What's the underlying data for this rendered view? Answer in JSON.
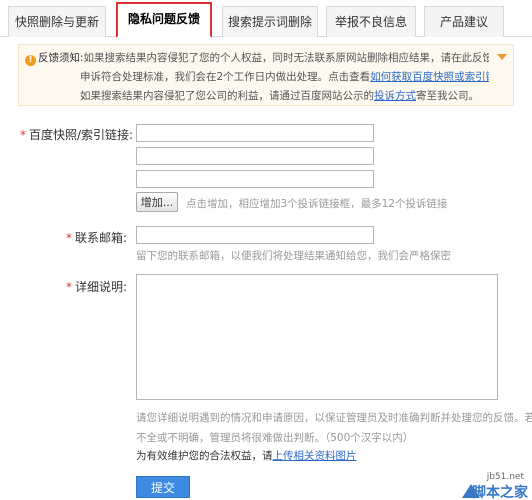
{
  "tabs": [
    {
      "label": "快照删除与更新",
      "active": false
    },
    {
      "label": "隐私问题反馈",
      "active": true
    },
    {
      "label": "搜索提示词删除",
      "active": false
    },
    {
      "label": "举报不良信息",
      "active": false
    },
    {
      "label": "产品建议",
      "active": false
    }
  ],
  "notice": {
    "lead": "反馈须知:",
    "text1": "如果搜索结果内容侵犯了您的个人权益，同时无法联系原网站删除相应结果，请在此反馈。若您的",
    "text2a": "申诉符合处理标准，我们会在2个工作日内做出处理。点击查看",
    "link1": "如何获取百度快照或索引链接地址",
    "text3a": "如果搜索结果内容侵犯了您公司的利益，请通过百度网站公示的",
    "link2": "投诉方式",
    "text3b": "寄至我公司。"
  },
  "form": {
    "url_label": "百度快照/索引链接:",
    "url_values": [
      "",
      "",
      ""
    ],
    "add_button": "增加...",
    "add_hint": "点击增加，相应增加3个投诉链接框，最多12个投诉链接",
    "email_label": "联系邮箱:",
    "email_value": "",
    "email_hint": "留下您的联系邮箱，以便我们将处理结果通知给您，我们会严格保密",
    "detail_label": "详细说明:",
    "detail_value": "",
    "detail_hint1": "请您详细说明遇到的情况和申请原因，以保证管理员及时准确判断并处理您的反馈。若信息",
    "detail_hint2": "不全或不明确，管理员将很难做出判断。（500个汉字以内）",
    "proof_text": "为有效维护您的合法权益，请",
    "proof_link": "上传相关资料图片",
    "submit": "提交",
    "required_mark": "*"
  },
  "watermark": {
    "url": "jb51.net",
    "name": "脚本之家"
  }
}
